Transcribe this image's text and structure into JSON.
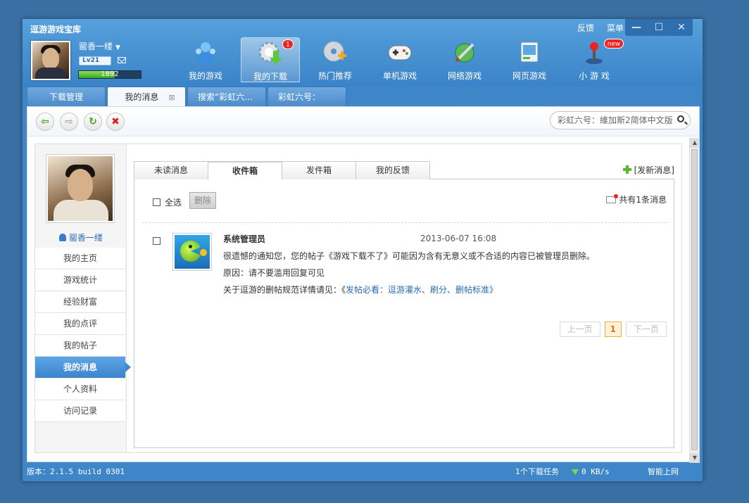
{
  "app": {
    "title": "逗游游戏宝库",
    "links": [
      "反馈",
      "菜单"
    ],
    "controls": [
      "—",
      "☐",
      "✕"
    ]
  },
  "user": {
    "name": "罂香一缕",
    "level": "Lv21",
    "exp": "1892",
    "exp_fraction": 0.58
  },
  "nav": [
    {
      "label": "我的游戏",
      "icon": "user-group-icon"
    },
    {
      "label": "我的下载",
      "icon": "download-gear-icon",
      "badge": "1",
      "active": true
    },
    {
      "label": "热门推荐",
      "icon": "disc-plus-icon"
    },
    {
      "label": "单机游戏",
      "icon": "gamepad-icon"
    },
    {
      "label": "网络游戏",
      "icon": "globe-sword-icon"
    },
    {
      "label": "网页游戏",
      "icon": "web-screen-icon"
    },
    {
      "label": "小 游 戏",
      "icon": "joystick-icon",
      "badge": "new"
    }
  ],
  "tabs": [
    {
      "label": "下载管理"
    },
    {
      "label": "我的消息",
      "active": true,
      "close": "⊠"
    },
    {
      "label": "搜索“彩虹六..."
    },
    {
      "label": "彩虹六号：維..."
    }
  ],
  "search": {
    "value": "彩虹六号：維加斯2简体中文版"
  },
  "sidebar": {
    "username": "罂香一缕",
    "items": [
      {
        "label": "我的主页"
      },
      {
        "label": "游戏统计"
      },
      {
        "label": "经验财富"
      },
      {
        "label": "我的点评"
      },
      {
        "label": "我的帖子"
      },
      {
        "label": "我的消息",
        "active": true
      },
      {
        "label": "个人资料"
      },
      {
        "label": "访问记录"
      }
    ]
  },
  "messages": {
    "tabs": [
      "未读消息",
      "收件箱",
      "发件箱",
      "我的反馈"
    ],
    "active_tab": "收件箱",
    "new_label": "[发新消息]",
    "select_all": "全选",
    "delete": "删除",
    "total": "共有1条消息",
    "items": [
      {
        "sender": "系统管理员",
        "time": "2013-06-07 16:08",
        "line1": "很遗憾的通知您，您的帖子《游戏下载不了》可能因为含有无意义或不合适的内容已被管理员删除。",
        "line2": "原因：请不要滥用回复可见",
        "line3_prefix": "关于逗游的删帖规范详情请见：《",
        "line3_link": "发帖必看：逗游灌水、刷分、删帖标准",
        "line3_suffix": "》"
      }
    ],
    "pager": {
      "prev": "上一页",
      "current": "1",
      "next": "下一页"
    }
  },
  "status": {
    "version": "版本：2.1.5 build 0301",
    "tasks": "1个下载任务",
    "speed": "0 KB/s",
    "network": "智能上网"
  }
}
